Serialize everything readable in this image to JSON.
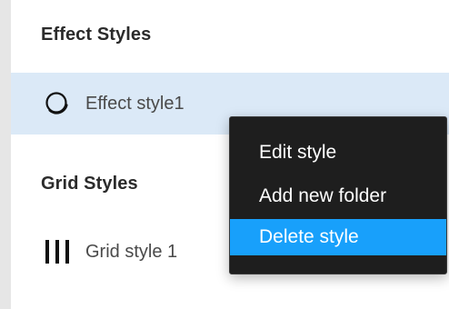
{
  "effect_styles": {
    "title": "Effect Styles",
    "items": [
      {
        "label": "Effect style1",
        "icon": "effect-circle-icon",
        "selected": true
      }
    ]
  },
  "grid_styles": {
    "title": "Grid Styles",
    "items": [
      {
        "label": "Grid style 1",
        "icon": "grid-columns-icon"
      }
    ]
  },
  "context_menu": {
    "items": [
      {
        "label": "Edit style"
      },
      {
        "label": "Add new folder"
      },
      {
        "label": "Delete style",
        "highlighted": true
      }
    ]
  },
  "colors": {
    "selected_row": "#dbe9f7",
    "menu_bg": "#1e1e1e",
    "menu_highlight": "#18a0fb"
  }
}
